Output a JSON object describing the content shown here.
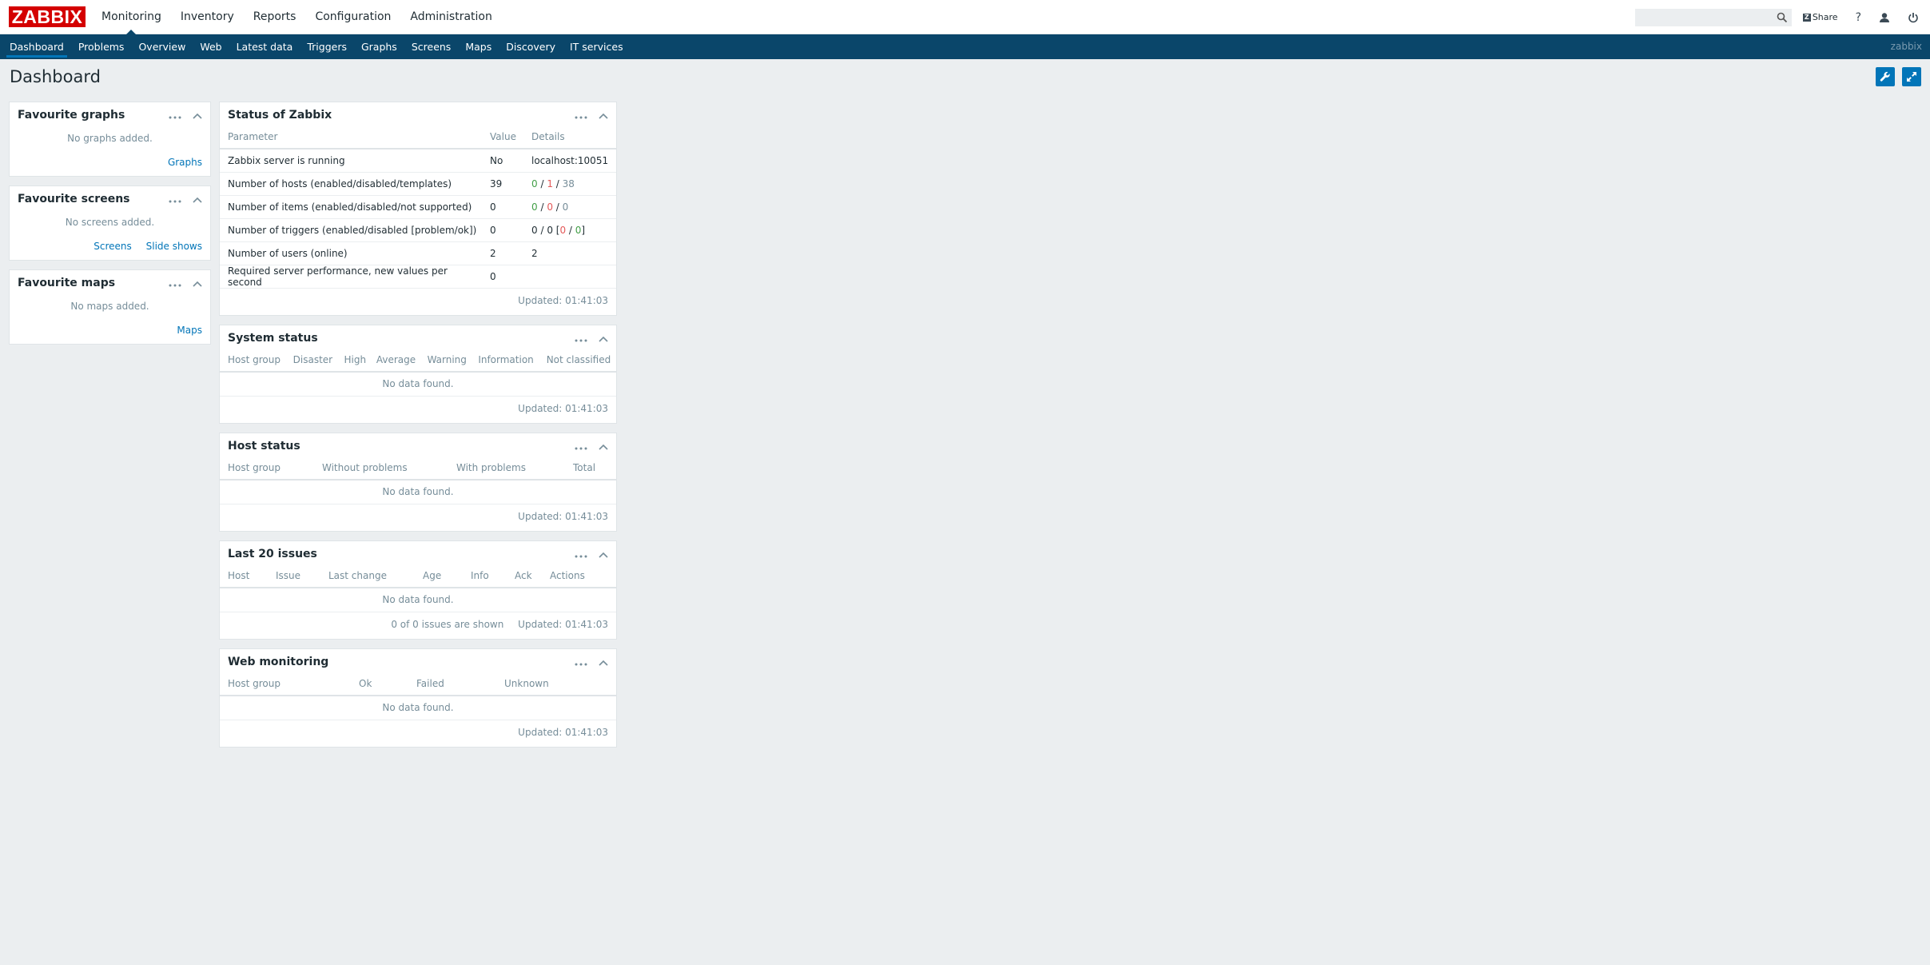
{
  "header": {
    "logo": "ZABBIX",
    "nav": [
      "Monitoring",
      "Inventory",
      "Reports",
      "Configuration",
      "Administration"
    ],
    "active_nav": "Monitoring",
    "search_value": "",
    "share_label": "Share",
    "help_label": "?"
  },
  "subnav": {
    "items": [
      "Dashboard",
      "Problems",
      "Overview",
      "Web",
      "Latest data",
      "Triggers",
      "Graphs",
      "Screens",
      "Maps",
      "Discovery",
      "IT services"
    ],
    "active": "Dashboard",
    "server_name": "zabbix"
  },
  "page": {
    "title": "Dashboard"
  },
  "fav_graphs": {
    "title": "Favourite graphs",
    "empty": "No graphs added.",
    "link": "Graphs"
  },
  "fav_screens": {
    "title": "Favourite screens",
    "empty": "No screens added.",
    "link1": "Screens",
    "link2": "Slide shows"
  },
  "fav_maps": {
    "title": "Favourite maps",
    "empty": "No maps added.",
    "link": "Maps"
  },
  "status_zabbix": {
    "title": "Status of Zabbix",
    "cols": [
      "Parameter",
      "Value",
      "Details"
    ],
    "rows": [
      {
        "param": "Zabbix server is running",
        "value": "No",
        "details": "localhost:10051"
      },
      {
        "param": "Number of hosts (enabled/disabled/templates)",
        "value": "39",
        "d1": "0",
        "d2": "1",
        "d3": "38"
      },
      {
        "param": "Number of items (enabled/disabled/not supported)",
        "value": "0",
        "d1": "0",
        "d2": "0",
        "d3": "0"
      },
      {
        "param": "Number of triggers (enabled/disabled [problem/ok])",
        "value": "0",
        "d1": "0",
        "d2": "0",
        "d3": "0",
        "d4": "0"
      },
      {
        "param": "Number of users (online)",
        "value": "2",
        "details": "2"
      },
      {
        "param": "Required server performance, new values per second",
        "value": "0",
        "details": ""
      }
    ],
    "updated": "Updated: 01:41:03"
  },
  "system_status": {
    "title": "System status",
    "cols": [
      "Host group",
      "Disaster",
      "High",
      "Average",
      "Warning",
      "Information",
      "Not classified"
    ],
    "empty": "No data found.",
    "updated": "Updated: 01:41:03"
  },
  "host_status": {
    "title": "Host status",
    "cols": [
      "Host group",
      "Without problems",
      "With problems",
      "Total"
    ],
    "empty": "No data found.",
    "updated": "Updated: 01:41:03"
  },
  "last_issues": {
    "title": "Last 20 issues",
    "cols": [
      "Host",
      "Issue",
      "Last change",
      "Age",
      "Info",
      "Ack",
      "Actions"
    ],
    "empty": "No data found.",
    "shown": "0 of 0 issues are shown",
    "updated": "Updated: 01:41:03"
  },
  "web_monitoring": {
    "title": "Web monitoring",
    "cols": [
      "Host group",
      "Ok",
      "Failed",
      "Unknown"
    ],
    "empty": "No data found.",
    "updated": "Updated: 01:41:03"
  },
  "colors": {
    "brand": "#d40000",
    "nav_bg": "#0a466a",
    "link": "#0275b8",
    "ok": "#429e47",
    "problem": "#e45959"
  }
}
